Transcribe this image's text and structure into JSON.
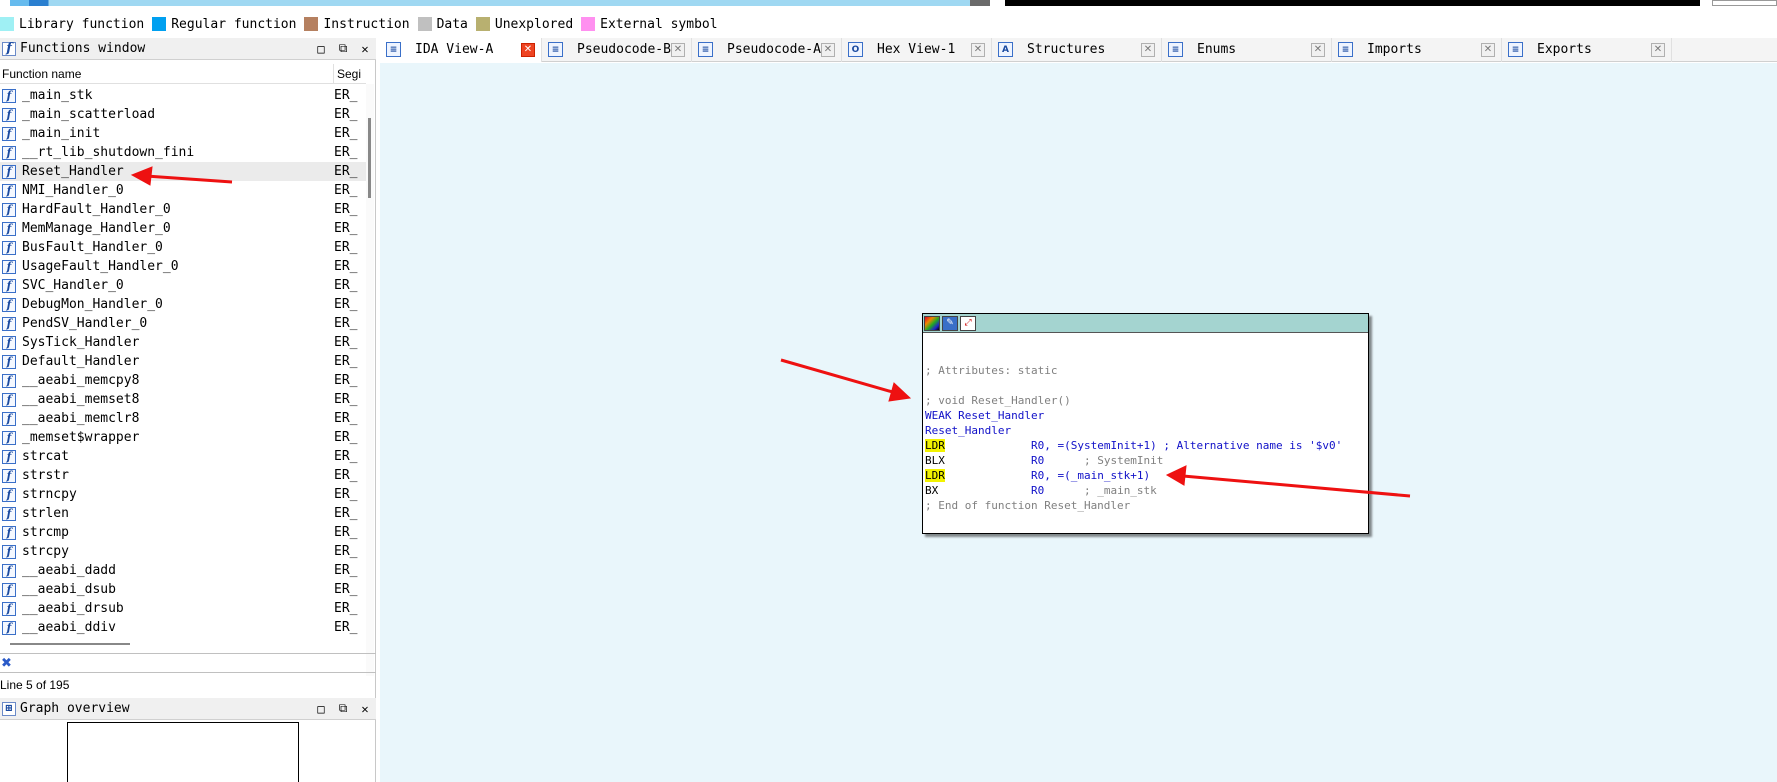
{
  "legend": [
    {
      "label": "Library function",
      "color": "#9ff0f4"
    },
    {
      "label": "Regular function",
      "color": "#00a0f0"
    },
    {
      "label": "Instruction",
      "color": "#b58060"
    },
    {
      "label": "Data",
      "color": "#c0c0c0"
    },
    {
      "label": "Unexplored",
      "color": "#b8b070"
    },
    {
      "label": "External symbol",
      "color": "#ff90f0"
    }
  ],
  "functions_window": {
    "title": "Functions window",
    "col_name": "Function name",
    "col_segment": "Segi",
    "rows": [
      {
        "name": "_main_stk",
        "seg": "ER_"
      },
      {
        "name": "_main_scatterload",
        "seg": "ER_"
      },
      {
        "name": "_main_init",
        "seg": "ER_"
      },
      {
        "name": "__rt_lib_shutdown_fini",
        "seg": "ER_"
      },
      {
        "name": "Reset_Handler",
        "seg": "ER_"
      },
      {
        "name": "NMI_Handler_0",
        "seg": "ER_"
      },
      {
        "name": "HardFault_Handler_0",
        "seg": "ER_"
      },
      {
        "name": "MemManage_Handler_0",
        "seg": "ER_"
      },
      {
        "name": "BusFault_Handler_0",
        "seg": "ER_"
      },
      {
        "name": "UsageFault_Handler_0",
        "seg": "ER_"
      },
      {
        "name": "SVC_Handler_0",
        "seg": "ER_"
      },
      {
        "name": "DebugMon_Handler_0",
        "seg": "ER_"
      },
      {
        "name": "PendSV_Handler_0",
        "seg": "ER_"
      },
      {
        "name": "SysTick_Handler",
        "seg": "ER_"
      },
      {
        "name": "Default_Handler",
        "seg": "ER_"
      },
      {
        "name": "__aeabi_memcpy8",
        "seg": "ER_"
      },
      {
        "name": "__aeabi_memset8",
        "seg": "ER_"
      },
      {
        "name": "__aeabi_memclr8",
        "seg": "ER_"
      },
      {
        "name": "_memset$wrapper",
        "seg": "ER_"
      },
      {
        "name": "strcat",
        "seg": "ER_"
      },
      {
        "name": "strstr",
        "seg": "ER_"
      },
      {
        "name": "strncpy",
        "seg": "ER_"
      },
      {
        "name": "strlen",
        "seg": "ER_"
      },
      {
        "name": "strcmp",
        "seg": "ER_"
      },
      {
        "name": "strcpy",
        "seg": "ER_"
      },
      {
        "name": "__aeabi_dadd",
        "seg": "ER_"
      },
      {
        "name": "__aeabi_dsub",
        "seg": "ER_"
      },
      {
        "name": "__aeabi_drsub",
        "seg": "ER_"
      },
      {
        "name": "__aeabi_ddiv",
        "seg": "ER_"
      }
    ],
    "selected_index": 4,
    "line_info": "Line 5 of 195"
  },
  "graph_overview": {
    "title": "Graph overview"
  },
  "pane_buttons": {
    "restore": "□",
    "float": "⧉",
    "close": "✕"
  },
  "tabs": [
    {
      "label": "IDA View-A",
      "icon": "ida-view-icon",
      "glyph": "≡",
      "active": true
    },
    {
      "label": "Pseudocode-B",
      "icon": "pseudocode-icon",
      "glyph": "≡",
      "active": false
    },
    {
      "label": "Pseudocode-A",
      "icon": "pseudocode-icon",
      "glyph": "≡",
      "active": false
    },
    {
      "label": "Hex View-1",
      "icon": "hex-view-icon",
      "glyph": "O",
      "active": false
    },
    {
      "label": "Structures",
      "icon": "structures-icon",
      "glyph": "A",
      "active": false
    },
    {
      "label": "Enums",
      "icon": "enums-icon",
      "glyph": "≡",
      "active": false
    },
    {
      "label": "Imports",
      "icon": "imports-icon",
      "glyph": "≡",
      "active": false
    },
    {
      "label": "Exports",
      "icon": "exports-icon",
      "glyph": "≡",
      "active": false
    }
  ],
  "node": {
    "attributes": "; Attributes: static",
    "proto": "; void Reset_Handler()",
    "weak": "WEAK Reset_Handler",
    "label": "Reset_Handler",
    "instr": [
      {
        "mn": "LDR",
        "hl": true,
        "op": "R0, =(SystemInit+1)",
        "cmt": " ; Alternative name is '$v0'",
        "cmt_style": "bl"
      },
      {
        "mn": "BLX",
        "hl": false,
        "op": "R0",
        "cmt": "      ; SystemInit",
        "cmt_style": "cm"
      },
      {
        "mn": "LDR",
        "hl": true,
        "op": "R0, =(_main_stk+1)",
        "cmt": "",
        "cmt_style": "cm"
      },
      {
        "mn": "BX",
        "hl": false,
        "op": "R0",
        "cmt": "      ; _main_stk",
        "cmt_style": "cm"
      }
    ],
    "end": "; End of function Reset_Handler"
  },
  "annotation_color": "#ee1111"
}
